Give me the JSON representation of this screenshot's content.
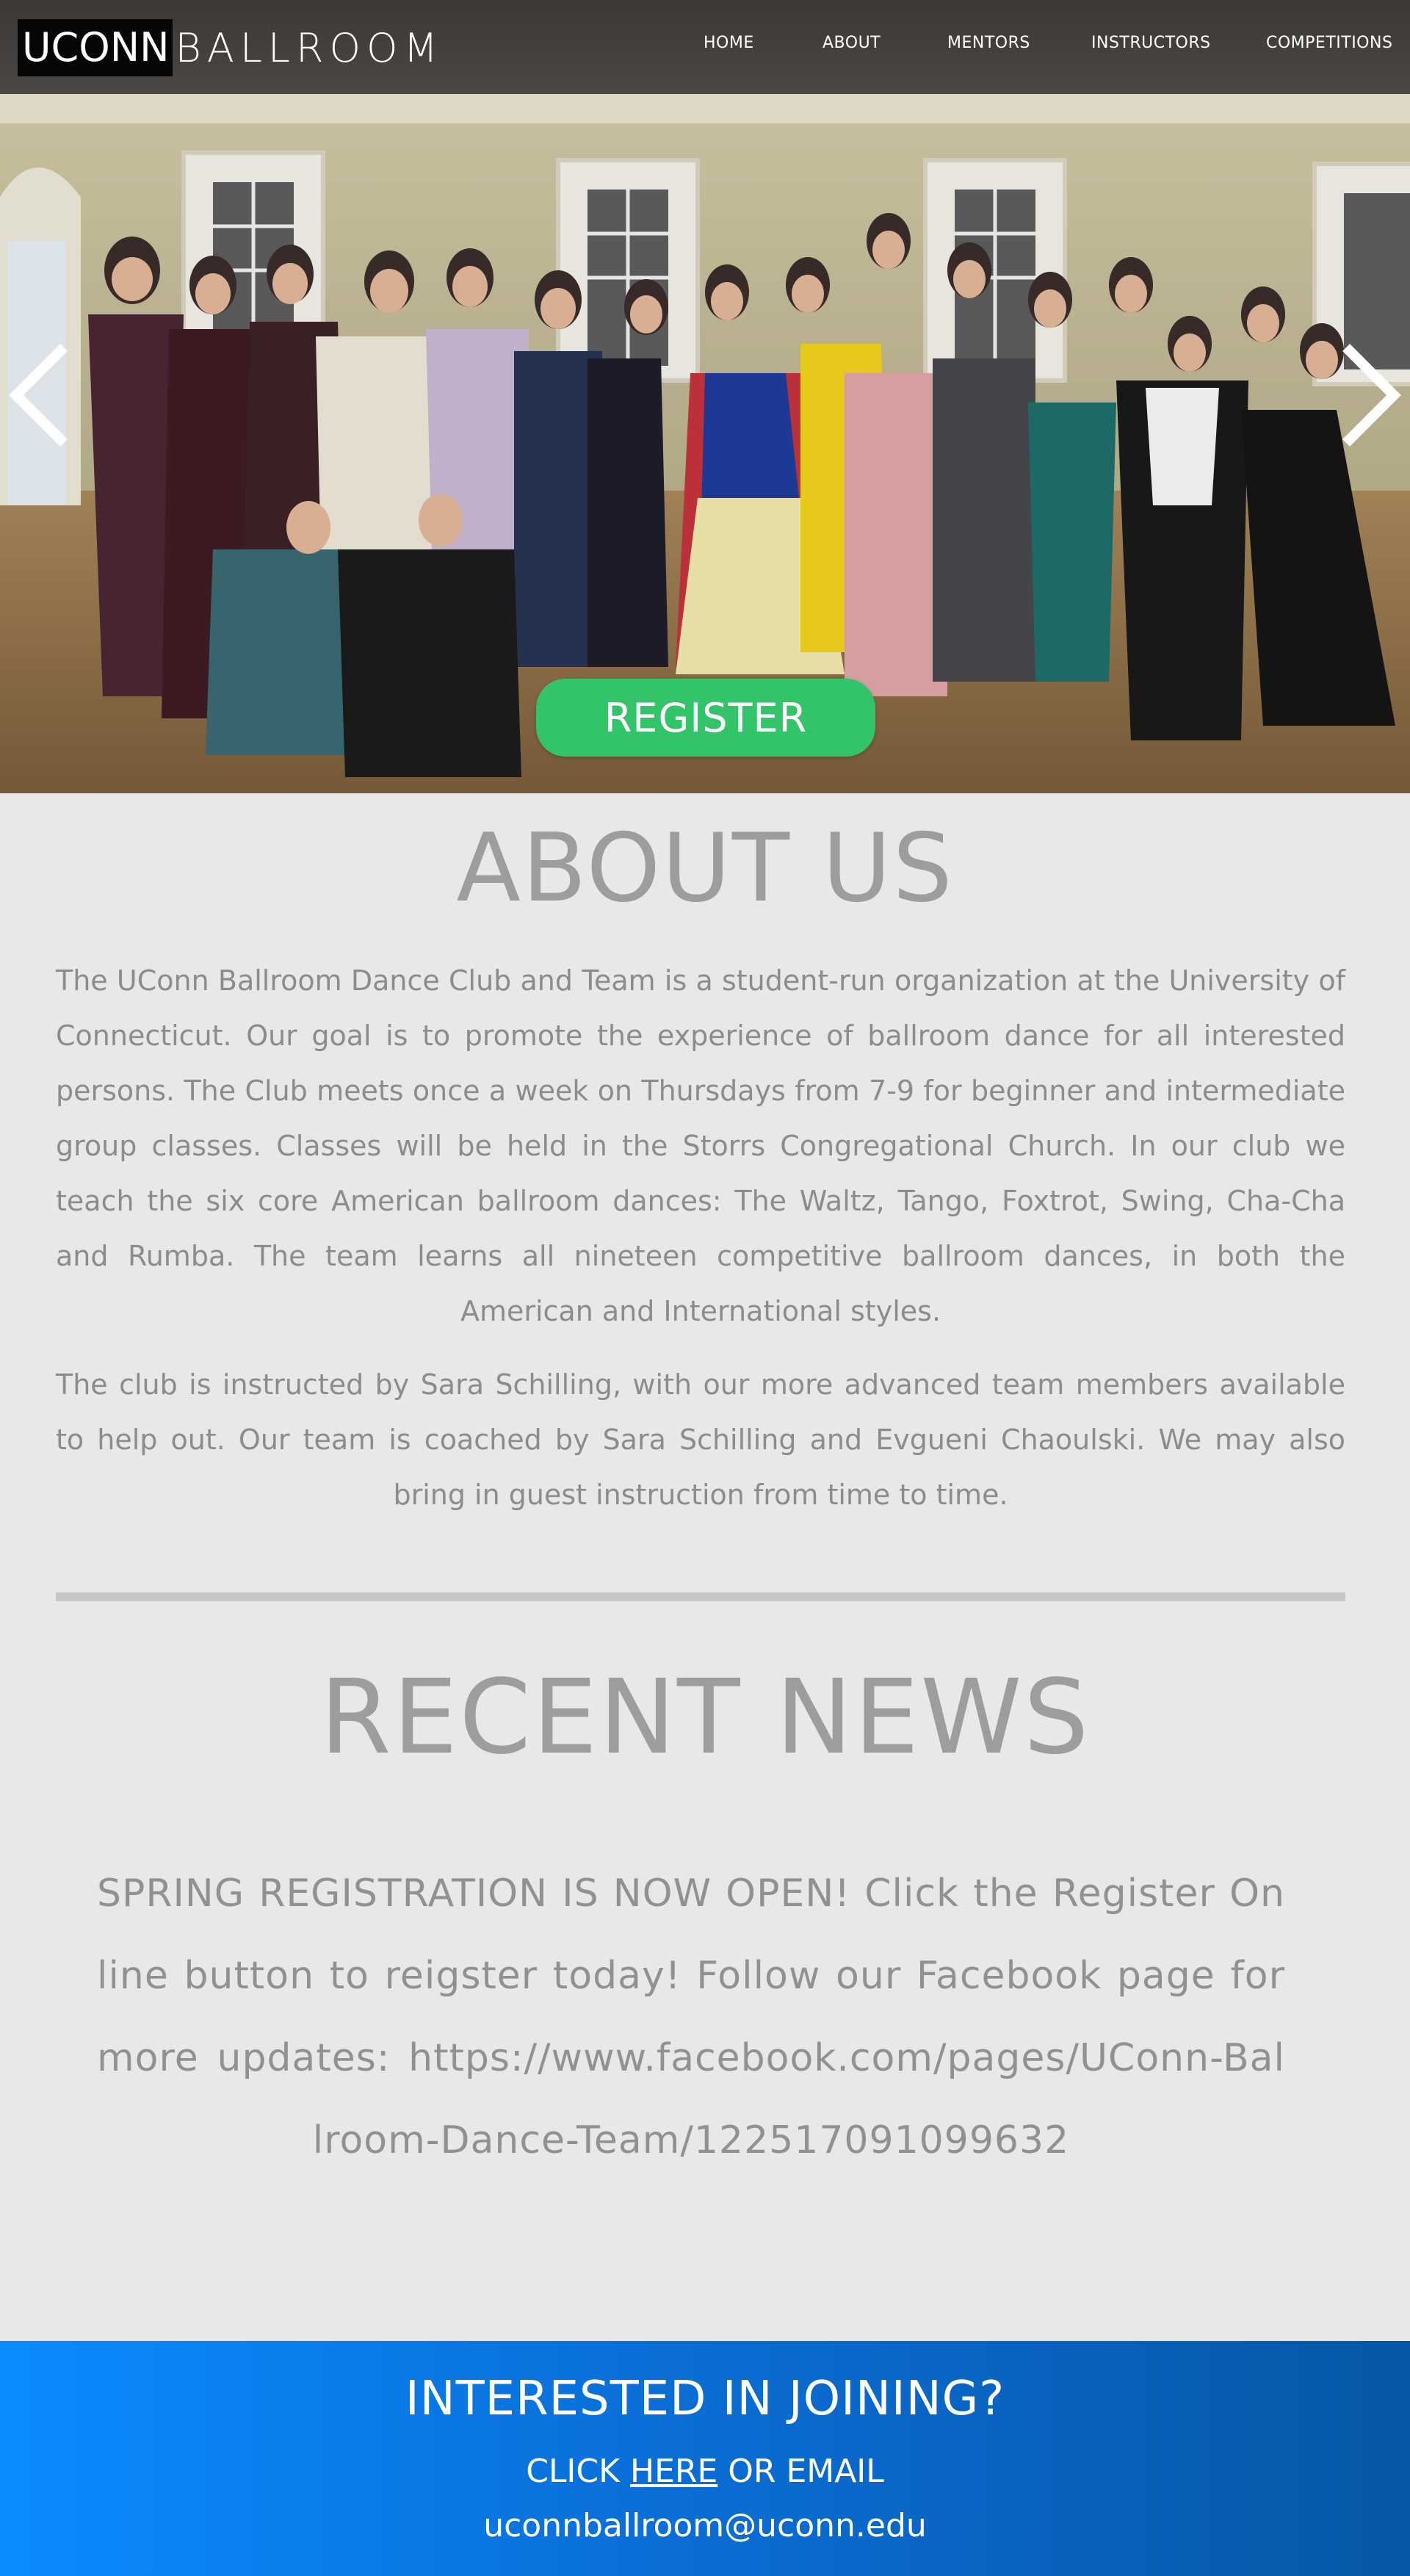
{
  "header": {
    "logo_box": "UCONN",
    "logo_rest": "BALLROOM",
    "nav": [
      "HOME",
      "ABOUT",
      "MENTORS",
      "INSTRUCTORS",
      "COMPETITIONS"
    ]
  },
  "hero": {
    "register_label": "REGISTER",
    "prev_icon": "chevron-left-icon",
    "next_icon": "chevron-right-icon"
  },
  "about": {
    "title": "ABOUT US",
    "paragraph_1": "The UConn Ballroom Dance Club and Team is a student-run organization at the University of Connecticut. Our goal is to promote the experience of ballroom dance for all interested persons. The Club meets once a week on Thursdays from 7-9 for beginner and intermediate group classes. Classes will be held in the Storrs Congregational Church. In our club we teach the six core American ballroom dances: The Waltz, Tango, Foxtrot, Swing, Cha-Cha and Rumba. The team learns all nineteen competitive ballroom dances, in both the American and International styles.",
    "paragraph_2": "The club is instructed by Sara Schilling, with our more advanced team members available to help out. Our team is coached by Sara Schilling and Evgueni Chaoulski. We may also bring in guest instruction from time to time."
  },
  "news": {
    "title": "RECENT NEWS",
    "body": "SPRING REGISTRATION IS NOW OPEN! Click the Register Online button to reigster today! Follow our Facebook page for more updates: https://www.facebook.com/pages/UConn-Ballroom-Dance-Team/122517091099632"
  },
  "footer": {
    "title": "INTERESTED IN JOINING?",
    "click_prefix": "CLICK",
    "here_link": "HERE",
    "click_suffix": "OR EMAIL",
    "email": "uconnballroom@uconn.edu"
  },
  "colors": {
    "page_bg": "#e8e8e8",
    "header_bg": "#3b3835",
    "register_green": "#33c46a",
    "heading_gray": "#9d9d9d",
    "footer_blue": "#0a8cff"
  }
}
